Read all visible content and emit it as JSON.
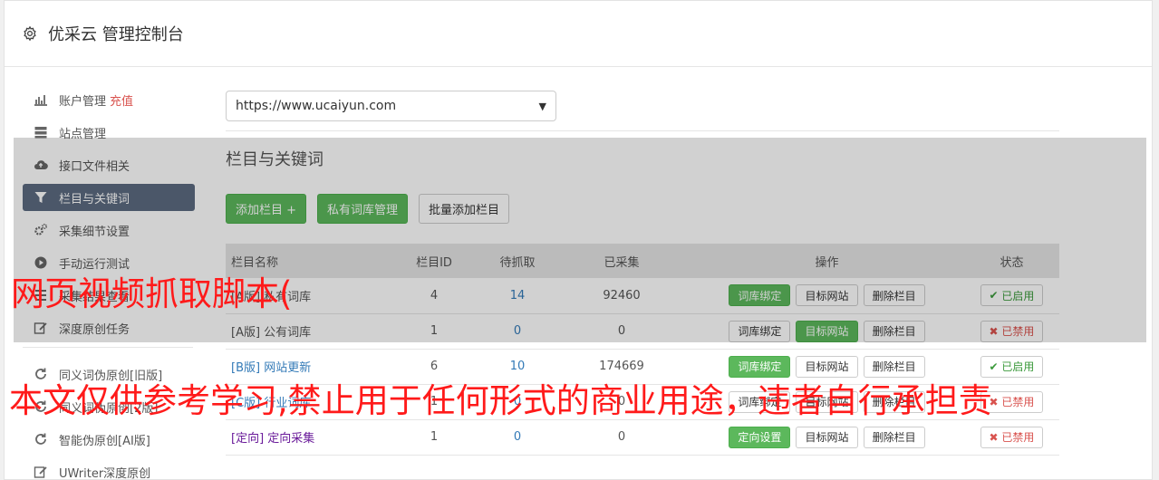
{
  "header": {
    "title": "优采云 管理控制台",
    "icon": "gear-icon"
  },
  "sidebar": {
    "items": [
      {
        "label": "账户管理",
        "extra": "充值",
        "icon": "bar-chart-icon"
      },
      {
        "label": "站点管理",
        "icon": "server-icon"
      },
      {
        "label": "接口文件相关",
        "icon": "cloud-upload-icon"
      },
      {
        "label": "栏目与关键词",
        "icon": "filter-icon",
        "active": true
      },
      {
        "label": "采集细节设置",
        "icon": "cogs-icon"
      },
      {
        "label": "手动运行测试",
        "icon": "play-icon"
      },
      {
        "label": "采集结果查看",
        "icon": "list-icon"
      },
      {
        "label": "深度原创任务",
        "icon": "edit-icon"
      },
      {
        "label": "同义词伪原创[旧版]",
        "icon": "refresh-icon"
      },
      {
        "label": "同义词伪原创[2版]",
        "icon": "refresh-icon"
      },
      {
        "label": "智能伪原创[AI版]",
        "icon": "refresh-icon"
      },
      {
        "label": "UWriter深度原创",
        "icon": "edit-icon"
      }
    ]
  },
  "main": {
    "site_select": "https://www.ucaiyun.com",
    "section_title": "栏目与关键词",
    "buttons": {
      "add_column": "添加栏目 +",
      "private_lib": "私有词库管理",
      "batch_add": "批量添加栏目"
    },
    "table": {
      "headers": [
        "栏目名称",
        "栏目ID",
        "待抓取",
        "已采集",
        "操作",
        "状态"
      ],
      "rows": [
        {
          "name": "[A版] 私有词库",
          "id": "4",
          "pending": "14",
          "collected": "92460",
          "op1": "词库绑定",
          "op2": "目标网站",
          "op3": "删除栏目",
          "status": "已启用"
        },
        {
          "name": "[A版] 公有词库",
          "id": "1",
          "pending": "0",
          "collected": "0",
          "op1": "词库绑定",
          "op2": "目标网站",
          "op3": "删除栏目",
          "status": "已禁用"
        },
        {
          "name": "[B版] 网站更新",
          "id": "6",
          "pending": "10",
          "collected": "174669",
          "op1": "词库绑定",
          "op2": "目标网站",
          "op3": "删除栏目",
          "status": "已启用"
        },
        {
          "name": "[C版] 行业词库",
          "id": "1",
          "pending": "0",
          "collected": "0",
          "op1": "词库绑定",
          "op2": "目标网站",
          "op3": "删除栏目",
          "status": "已禁用"
        },
        {
          "name": "[定向] 定向采集",
          "id": "1",
          "pending": "0",
          "collected": "0",
          "op1": "定向设置",
          "op2": "目标网站",
          "op3": "删除栏目",
          "status": "已禁用"
        }
      ]
    }
  },
  "watermark": {
    "line1": "网页视频抓取脚本(",
    "line2": "本文仅供参考学习,禁止用于任何形式的商业用途，违者自行承担责"
  },
  "colors": {
    "accent": "#5cb85c",
    "active_nav": "#5c6b80",
    "danger": "#d9534f",
    "link": "#337ab7"
  }
}
